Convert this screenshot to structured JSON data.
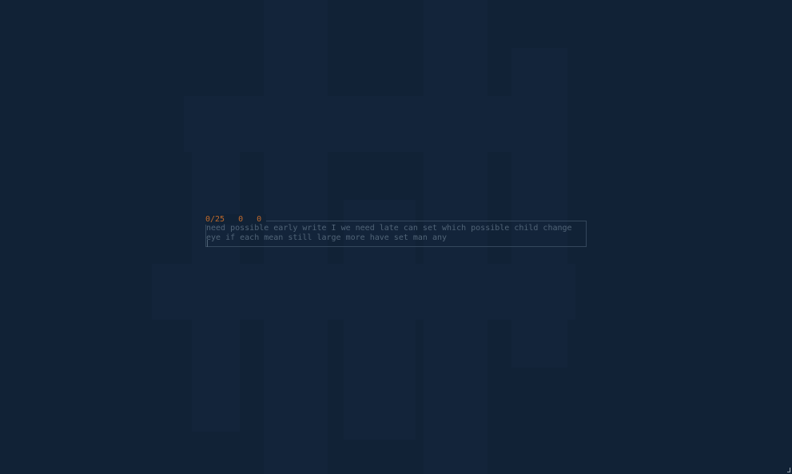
{
  "stats": {
    "progress": "0/25",
    "wpm": "0",
    "accuracy": "0"
  },
  "words": {
    "line1": "need possible early write I we need late can set which possible child change",
    "line2": "eye if each mean still large more have set man any"
  },
  "colors": {
    "background": "#112236",
    "accent": "#c06a2c",
    "text_dim": "#516477",
    "border": "#34475c"
  }
}
